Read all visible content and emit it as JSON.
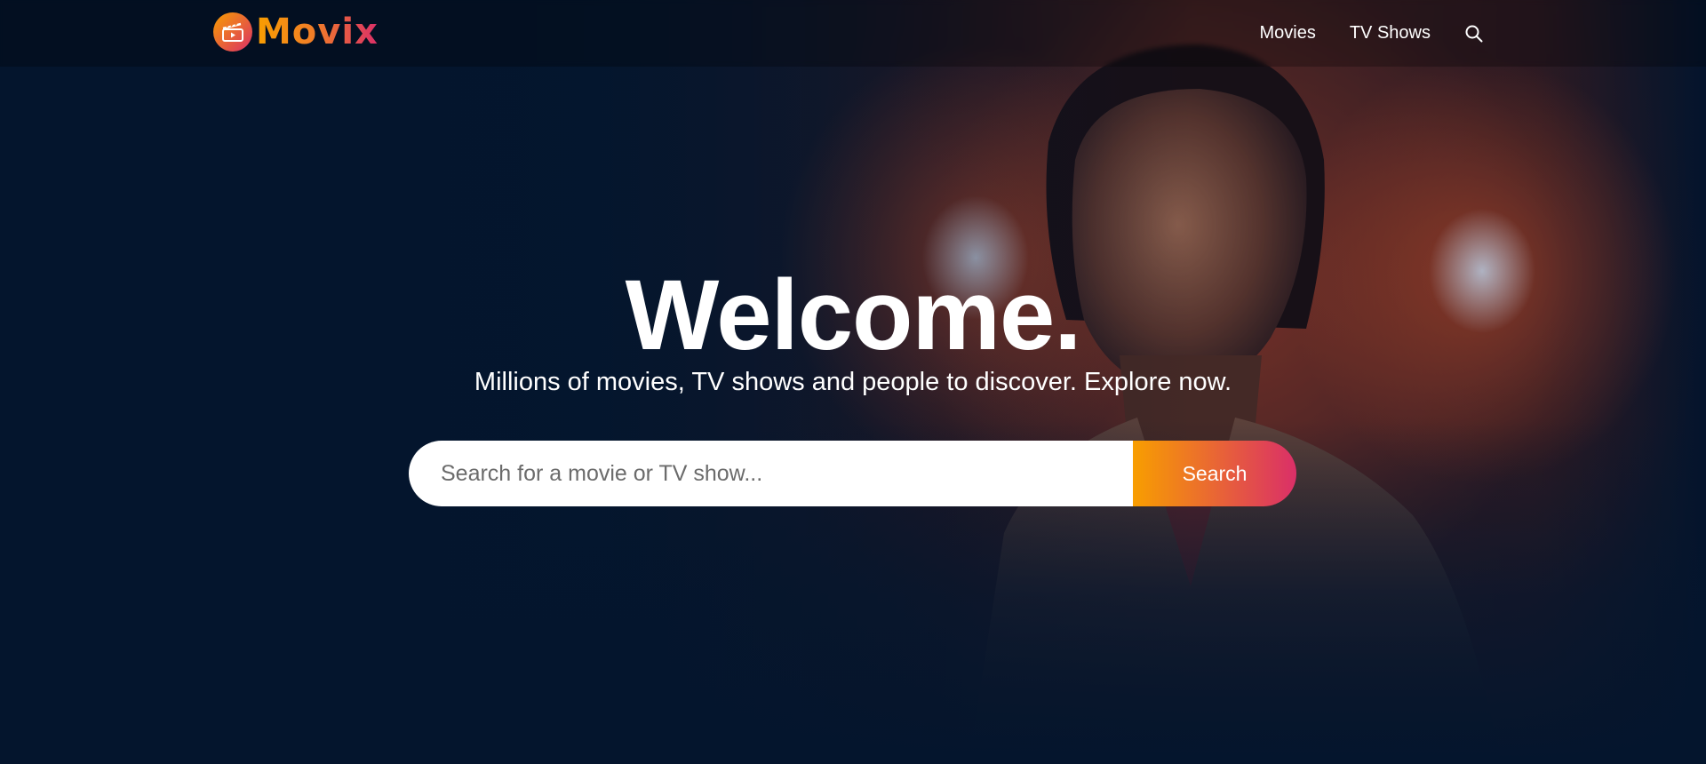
{
  "brand": {
    "name": "Movix",
    "logo_icon": "clapperboard-icon",
    "gradient_start": "#f89e00",
    "gradient_end": "#da2f68"
  },
  "nav": {
    "items": [
      {
        "label": "Movies"
      },
      {
        "label": "TV Shows"
      }
    ],
    "search_icon": "search-icon"
  },
  "hero": {
    "title": "Welcome.",
    "subtitle": "Millions of movies, TV shows and people to discover. Explore now.",
    "backdrop": "movie-backdrop-image"
  },
  "search": {
    "placeholder": "Search for a movie or TV show...",
    "value": "",
    "button_label": "Search"
  },
  "colors": {
    "background": "#04152d",
    "text": "#ffffff"
  }
}
